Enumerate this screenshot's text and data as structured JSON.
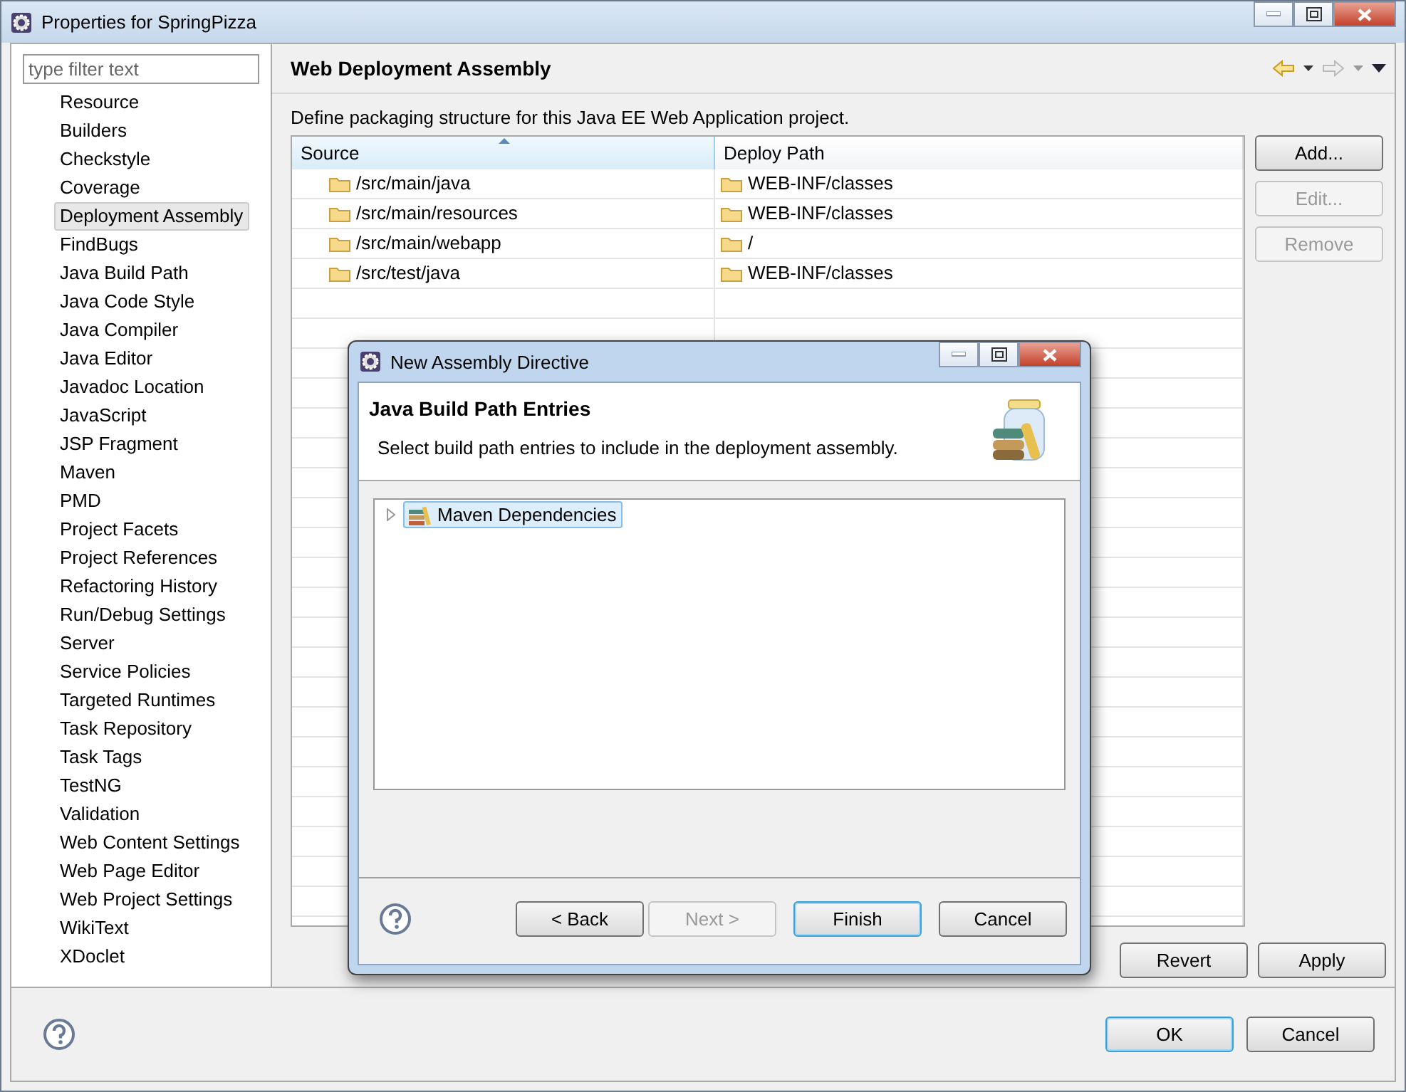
{
  "window": {
    "title": "Properties for SpringPizza"
  },
  "sidebar": {
    "filter": {
      "placeholder": "type filter text"
    },
    "items": [
      {
        "label": "Resource",
        "selected": false
      },
      {
        "label": "Builders",
        "selected": false
      },
      {
        "label": "Checkstyle",
        "selected": false
      },
      {
        "label": "Coverage",
        "selected": false
      },
      {
        "label": "Deployment Assembly",
        "selected": true
      },
      {
        "label": "FindBugs",
        "selected": false
      },
      {
        "label": "Java Build Path",
        "selected": false
      },
      {
        "label": "Java Code Style",
        "selected": false
      },
      {
        "label": "Java Compiler",
        "selected": false
      },
      {
        "label": "Java Editor",
        "selected": false
      },
      {
        "label": "Javadoc Location",
        "selected": false
      },
      {
        "label": "JavaScript",
        "selected": false
      },
      {
        "label": "JSP Fragment",
        "selected": false
      },
      {
        "label": "Maven",
        "selected": false
      },
      {
        "label": "PMD",
        "selected": false
      },
      {
        "label": "Project Facets",
        "selected": false
      },
      {
        "label": "Project References",
        "selected": false
      },
      {
        "label": "Refactoring History",
        "selected": false
      },
      {
        "label": "Run/Debug Settings",
        "selected": false
      },
      {
        "label": "Server",
        "selected": false
      },
      {
        "label": "Service Policies",
        "selected": false
      },
      {
        "label": "Targeted Runtimes",
        "selected": false
      },
      {
        "label": "Task Repository",
        "selected": false
      },
      {
        "label": "Task Tags",
        "selected": false
      },
      {
        "label": "TestNG",
        "selected": false
      },
      {
        "label": "Validation",
        "selected": false
      },
      {
        "label": "Web Content Settings",
        "selected": false
      },
      {
        "label": "Web Page Editor",
        "selected": false
      },
      {
        "label": "Web Project Settings",
        "selected": false
      },
      {
        "label": "WikiText",
        "selected": false
      },
      {
        "label": "XDoclet",
        "selected": false
      }
    ]
  },
  "page": {
    "title": "Web Deployment Assembly",
    "description": "Define packaging structure for this Java EE Web Application project.",
    "table": {
      "columns": [
        "Source",
        "Deploy Path"
      ],
      "rows": [
        {
          "source": "/src/main/java",
          "deploy_path": "WEB-INF/classes"
        },
        {
          "source": "/src/main/resources",
          "deploy_path": "WEB-INF/classes"
        },
        {
          "source": "/src/main/webapp",
          "deploy_path": "/"
        },
        {
          "source": "/src/test/java",
          "deploy_path": "WEB-INF/classes"
        }
      ]
    },
    "side_buttons": [
      {
        "label": "Add...",
        "disabled": false
      },
      {
        "label": "Edit...",
        "disabled": true
      },
      {
        "label": "Remove",
        "disabled": true
      }
    ],
    "buttons": [
      {
        "label": "Revert",
        "disabled": false
      },
      {
        "label": "Apply",
        "disabled": false
      }
    ]
  },
  "footer_buttons": [
    {
      "label": "OK",
      "default": true
    },
    {
      "label": "Cancel",
      "default": false
    }
  ],
  "dialog": {
    "title": "New Assembly Directive",
    "heading": "Java Build Path Entries",
    "description": "Select build path entries to include in the deployment assembly.",
    "tree": [
      {
        "label": "Maven Dependencies",
        "selected": true,
        "expanded": false
      }
    ],
    "buttons": [
      {
        "label": "< Back",
        "disabled": false,
        "default": false
      },
      {
        "label": "Next >",
        "disabled": true,
        "default": false
      },
      {
        "label": "Finish",
        "disabled": false,
        "default": true
      },
      {
        "label": "Cancel",
        "disabled": false,
        "default": false
      }
    ]
  }
}
